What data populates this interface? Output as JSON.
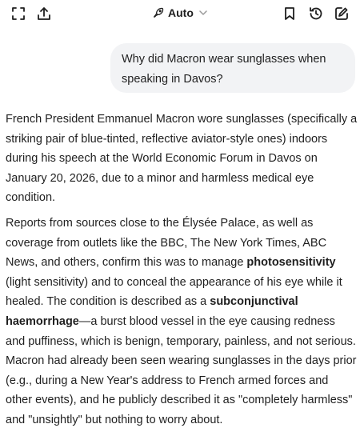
{
  "toolbar": {
    "mode_label": "Auto",
    "icons": [
      "expand-icon",
      "share-icon",
      "rocket-icon",
      "chevron-down-icon",
      "bookmark-icon",
      "history-icon",
      "edit-icon"
    ]
  },
  "conversation": {
    "user_message": "Why did Macron wear sunglasses when speaking in Davos?",
    "answer": {
      "p1": "French President Emmanuel Macron wore sunglasses (specifically a striking pair of blue-tinted, reflective aviator-style ones) indoors during his speech at the World Economic Forum in Davos on January 20, 2026, due to a minor and harmless medical eye condition.",
      "p2_a": "Reports from sources close to the Élysée Palace, as well as coverage from outlets like the BBC, The New York Times, ABC News, and others, confirm this was to manage ",
      "p2_bold1": "photosensitivity",
      "p2_b": " (light sensitivity) and to conceal the appearance of his eye while it healed. The condition is described as a ",
      "p2_bold2": "subconjunctival haemorrhage",
      "p2_c": "—a burst blood vessel in the eye causing redness and puffiness, which is benign, temporary, painless, and not serious. Macron had already been seen wearing sunglasses in the days prior (e.g., during a New Year's address to French armed forces and other events), and he publicly described it as \"completely harmless\" and \"unsightly\" but nothing to worry about."
    }
  }
}
